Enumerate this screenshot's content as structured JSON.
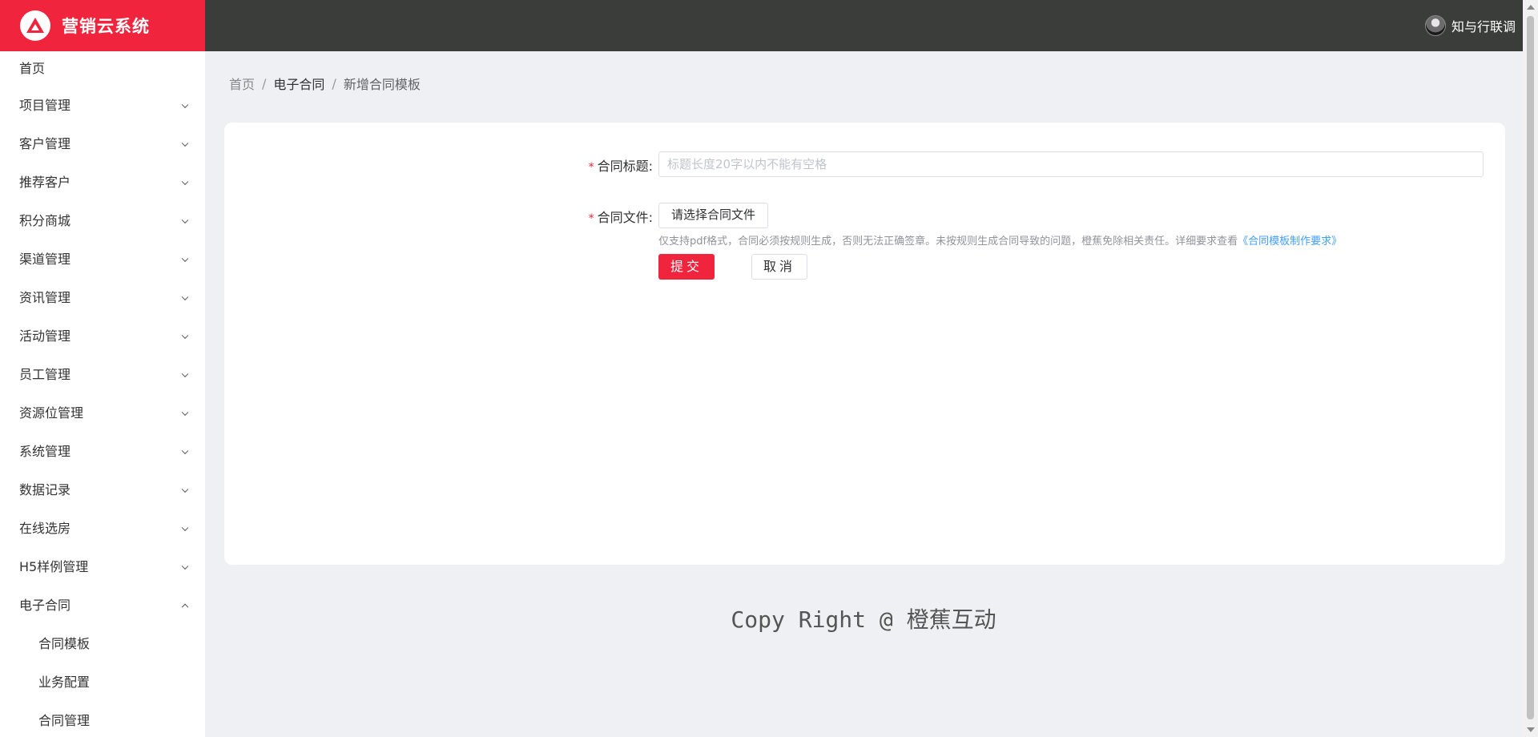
{
  "app": {
    "title": "营销云系统"
  },
  "user": {
    "name": "知与行联调"
  },
  "sidebar": {
    "items": [
      {
        "label": "首页",
        "expandable": false
      },
      {
        "label": "项目管理",
        "expandable": true
      },
      {
        "label": "客户管理",
        "expandable": true
      },
      {
        "label": "推荐客户",
        "expandable": true
      },
      {
        "label": "积分商城",
        "expandable": true
      },
      {
        "label": "渠道管理",
        "expandable": true
      },
      {
        "label": "资讯管理",
        "expandable": true
      },
      {
        "label": "活动管理",
        "expandable": true
      },
      {
        "label": "员工管理",
        "expandable": true
      },
      {
        "label": "资源位管理",
        "expandable": true
      },
      {
        "label": "系统管理",
        "expandable": true
      },
      {
        "label": "数据记录",
        "expandable": true
      },
      {
        "label": "在线选房",
        "expandable": true
      },
      {
        "label": "H5样例管理",
        "expandable": true
      },
      {
        "label": "电子合同",
        "expandable": true,
        "expanded": true
      }
    ],
    "sub_items": [
      "合同模板",
      "业务配置",
      "合同管理"
    ]
  },
  "breadcrumb": {
    "home": "首页",
    "section": "电子合同",
    "current": "新增合同模板",
    "separator": "/"
  },
  "form": {
    "required_mark": "*",
    "title_label": "合同标题:",
    "title_placeholder": "标题长度20字以内不能有空格",
    "title_value": "",
    "file_label": "合同文件:",
    "file_button": "请选择合同文件",
    "hint_text": "仅支持pdf格式，合同必须按规则生成，否则无法正确签章。未按规则生成合同导致的问题，橙蕉免除相关责任。详细要求查看",
    "hint_link": "《合同模板制作要求》",
    "submit_label": "提交",
    "cancel_label": "取消"
  },
  "footer": {
    "text": "Copy Right @ 橙蕉互动"
  },
  "colors": {
    "brand": "#f0243c",
    "header_bg": "#3b3d3b",
    "link": "#409eff",
    "content_bg": "#eff0f4"
  }
}
